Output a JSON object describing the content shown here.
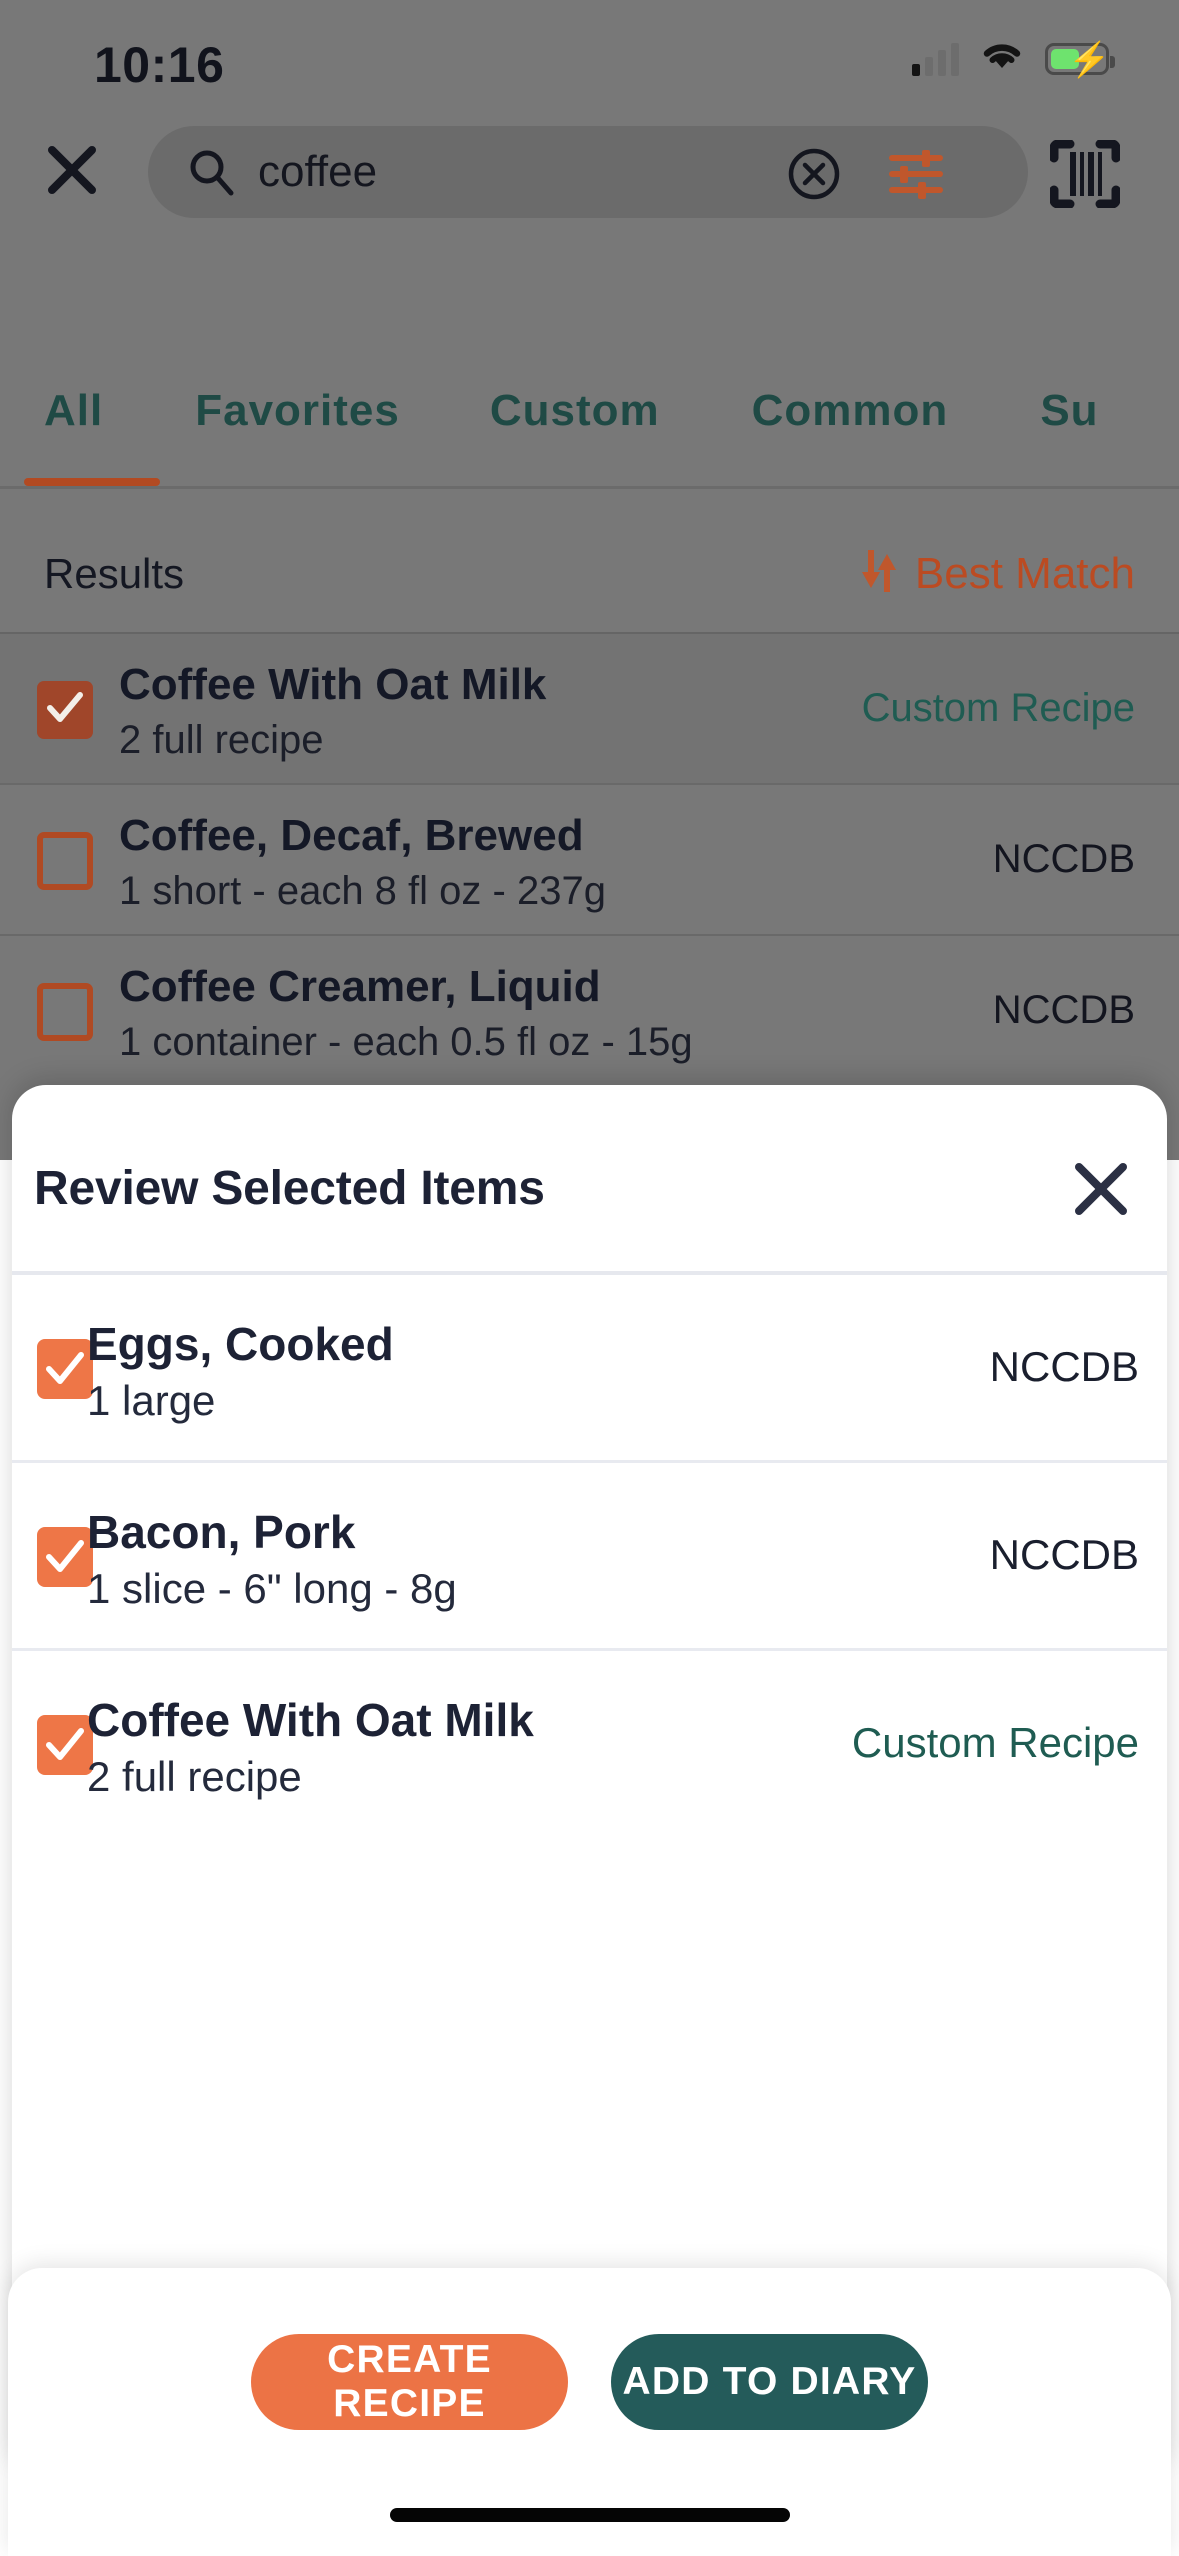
{
  "status_bar": {
    "time": "10:16",
    "signal_icon": "cellular-signal-icon",
    "wifi_icon": "wifi-icon",
    "battery_icon": "battery-charging-icon"
  },
  "search": {
    "close_icon": "close-icon",
    "search_icon": "search-icon",
    "value": "coffee",
    "placeholder": "Search foods",
    "clear_icon": "clear-circle-icon",
    "filter_icon": "filter-sliders-icon",
    "barcode_icon": "barcode-scanner-icon"
  },
  "tabs": [
    {
      "label": "All",
      "active": true
    },
    {
      "label": "Favorites",
      "active": false
    },
    {
      "label": "Custom",
      "active": false
    },
    {
      "label": "Common",
      "active": false
    },
    {
      "label": "Su",
      "active": false
    }
  ],
  "results_header": {
    "label": "Results",
    "sort_label": "Best Match",
    "sort_icon": "sort-arrows-icon"
  },
  "results": [
    {
      "name": "Coffee With Oat Milk",
      "serving": "2 full recipe",
      "source": "Custom Recipe",
      "source_type": "custom",
      "checked": true
    },
    {
      "name": "Coffee, Decaf, Brewed",
      "serving": "1 short - each 8 fl oz - 237g",
      "source": "NCCDB",
      "source_type": "nccdb",
      "checked": false
    },
    {
      "name": "Coffee Creamer, Liquid",
      "serving": "1 container - each 0.5 fl oz - 15g",
      "source": "NCCDB",
      "source_type": "nccdb",
      "checked": false
    }
  ],
  "sheet": {
    "title": "Review Selected Items",
    "close_icon": "close-icon",
    "items": [
      {
        "name": "Eggs, Cooked",
        "serving": "1 large",
        "source": "NCCDB",
        "source_type": "nccdb",
        "checked": true
      },
      {
        "name": "Bacon, Pork",
        "serving": "1 slice - 6\" long - 8g",
        "source": "NCCDB",
        "source_type": "nccdb",
        "checked": true
      },
      {
        "name": "Coffee With Oat Milk",
        "serving": "2 full recipe",
        "source": "Custom Recipe",
        "source_type": "custom",
        "checked": true
      }
    ]
  },
  "actions": {
    "create_recipe_label": "CREATE RECIPE",
    "add_to_diary_label": "ADD TO DIARY"
  },
  "colors": {
    "accent_orange": "#ec7345",
    "accent_teal": "#245b5a",
    "sort_orange": "#bb4b22",
    "custom_recipe_green": "#1f5c52",
    "text_dark": "#1d2235",
    "overlay": "#787878"
  }
}
